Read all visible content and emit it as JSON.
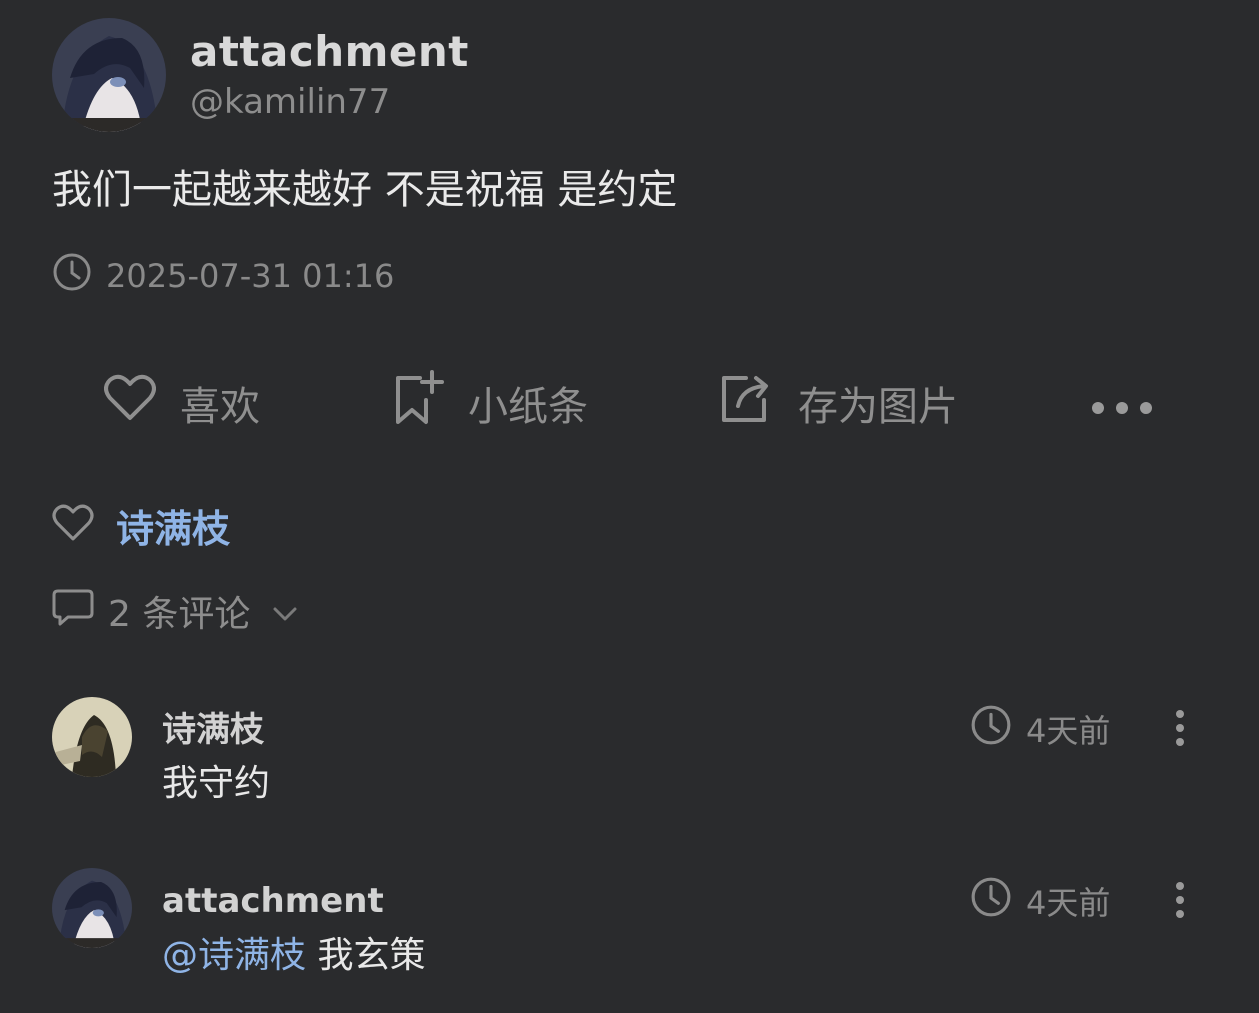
{
  "post": {
    "username": "attachment",
    "handle": "@kamilin77",
    "text": "我们一起越来越好 不是祝福 是约定",
    "timestamp": "2025-07-31 01:16"
  },
  "actions": {
    "like_label": "喜欢",
    "note_label": "小纸条",
    "save_label": "存为图片"
  },
  "likes": {
    "liker": "诗满枝"
  },
  "comments_summary": {
    "label": "2 条评论"
  },
  "comments": [
    {
      "name": "诗满枝",
      "text": "我守约",
      "time": "4天前"
    },
    {
      "name": "attachment",
      "mention": "@诗满枝",
      "text": " 我玄策",
      "time": "4天前"
    }
  ],
  "icons": {
    "time": "clock-icon",
    "like": "heart-icon",
    "note": "bookmark-plus-icon",
    "save": "share-image-icon",
    "more": "more-horizontal-icon",
    "comment": "comment-bubble-icon",
    "expand": "chevron-down-icon",
    "comment_menu": "more-vertical-icon"
  },
  "colors": {
    "background": "#2a2b2d",
    "accent": "#8fb4e6"
  }
}
